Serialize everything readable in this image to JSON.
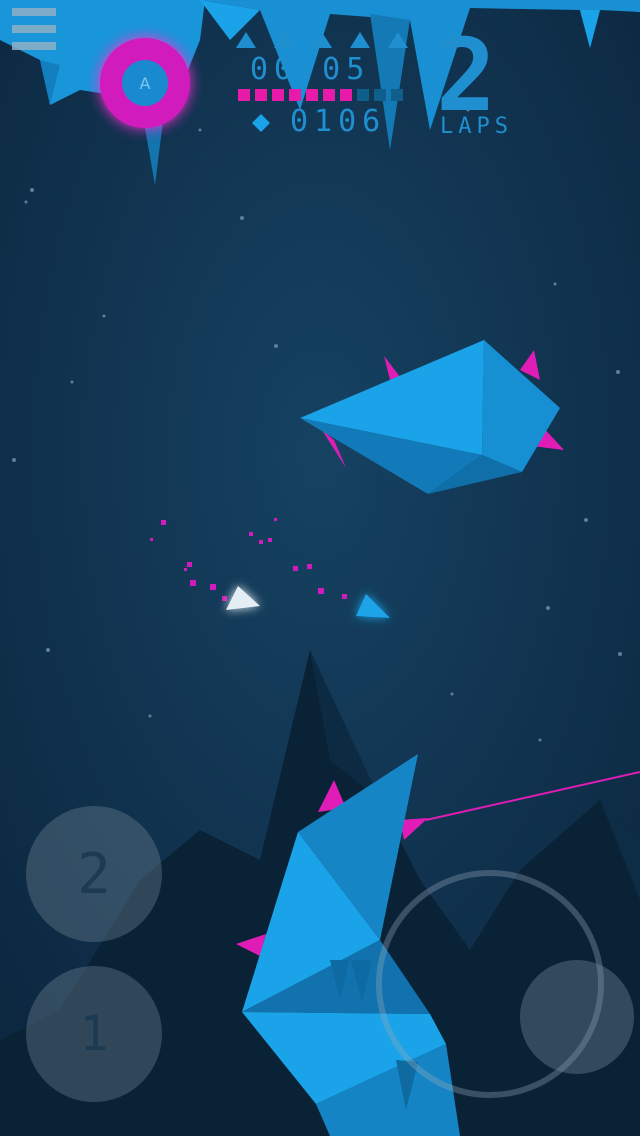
{
  "hud": {
    "timer": "00:05",
    "gems": "0106",
    "laps_value": "2",
    "laps_label": "LAPS",
    "lives_total": 5,
    "boost_segments_total": 10,
    "boost_segments_filled": 7,
    "boost_badge_letter": "A"
  },
  "controls": {
    "button_top_label": "2",
    "button_bottom_label": "1"
  },
  "icons": {
    "menu": "hamburger-menu-icon",
    "gem": "diamond-icon",
    "life": "triangle-icon"
  },
  "colors": {
    "background": "#0e2d47",
    "ice": "#1aa3e8",
    "spike": "#e01cb6",
    "hud": "#1f8fd0",
    "boost_filled": "#e81aa9",
    "boost_empty": "#0f5f8c"
  }
}
